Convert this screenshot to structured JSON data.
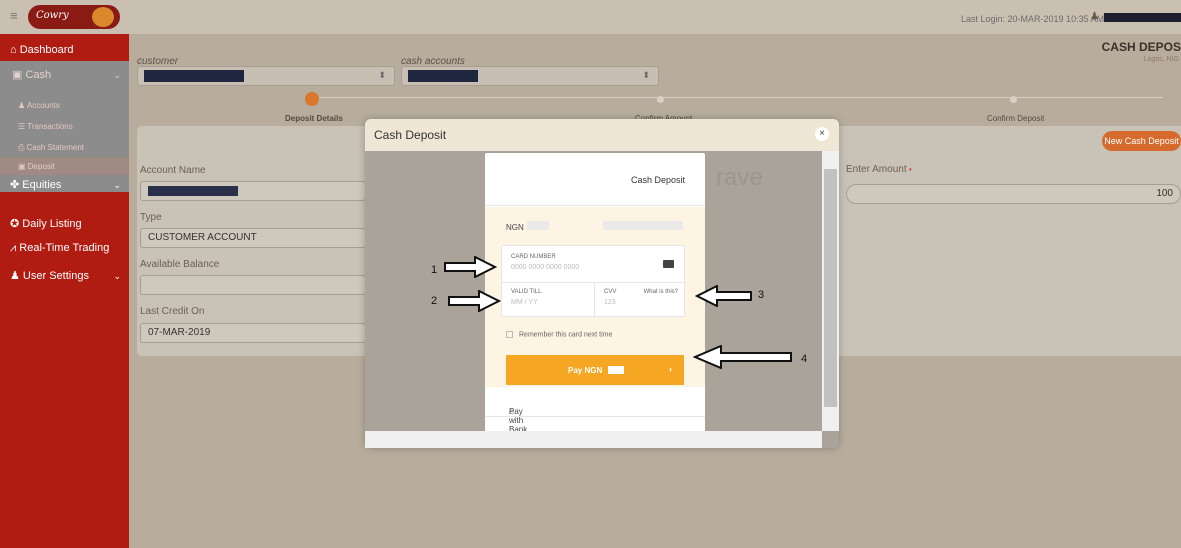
{
  "topbar": {
    "last_login": "Last Login: 20-MAR-2019 10:35 AM",
    "logo_text": "Cowry"
  },
  "sidebar": {
    "items": [
      {
        "label": "Dashboard",
        "icon": "home-icon"
      },
      {
        "label": "Cash",
        "icon": "cash-icon"
      },
      {
        "label": "Accounts",
        "icon": "accounts-icon"
      },
      {
        "label": "Transactions",
        "icon": "list-icon"
      },
      {
        "label": "Cash Statement",
        "icon": "print-icon"
      },
      {
        "label": "Deposit",
        "icon": "deposit-icon"
      },
      {
        "label": "Equities",
        "icon": "equities-icon"
      },
      {
        "label": "Daily Listing",
        "icon": "listing-icon"
      },
      {
        "label": "Real-Time Trading",
        "icon": "chart-icon"
      },
      {
        "label": "User Settings",
        "icon": "user-icon"
      }
    ]
  },
  "main": {
    "title": "CASH DEPOS",
    "subtitle": "Lagos, NIG",
    "customer_label": "customer",
    "cash_accounts_label": "cash accounts",
    "steps": [
      "Deposit Details",
      "Confirm Amount",
      "Confirm Deposit"
    ],
    "new_cash_deposit": "New Cash Deposit",
    "fields": {
      "account_name_label": "Account Name",
      "type_label": "Type",
      "type_value": "CUSTOMER ACCOUNT",
      "available_balance_label": "Available Balance",
      "last_credit_label": "Last Credit On",
      "last_credit_value": "07-MAR-2019",
      "enter_amount_label": "Enter Amount",
      "amount_value": "100"
    }
  },
  "modal": {
    "title": "Cash Deposit",
    "close": "×",
    "rave": {
      "header": "Cash Deposit",
      "close": "×",
      "logo": "rave",
      "ngn": "NGN",
      "card_number_label": "CARD NUMBER",
      "card_number_placeholder": "0000 0000 0000 0000",
      "valid_till_label": "VALID TILL",
      "valid_till_placeholder": "MM / YY",
      "cvv_label": "CVV",
      "cvv_placeholder": "123",
      "what_is_this": "What is this?",
      "remember": "Remember this card next time",
      "pay_label": "Pay NGN",
      "pay_with_bank": "Pay with Bank"
    },
    "annotations": [
      "1",
      "2",
      "3",
      "4"
    ]
  }
}
